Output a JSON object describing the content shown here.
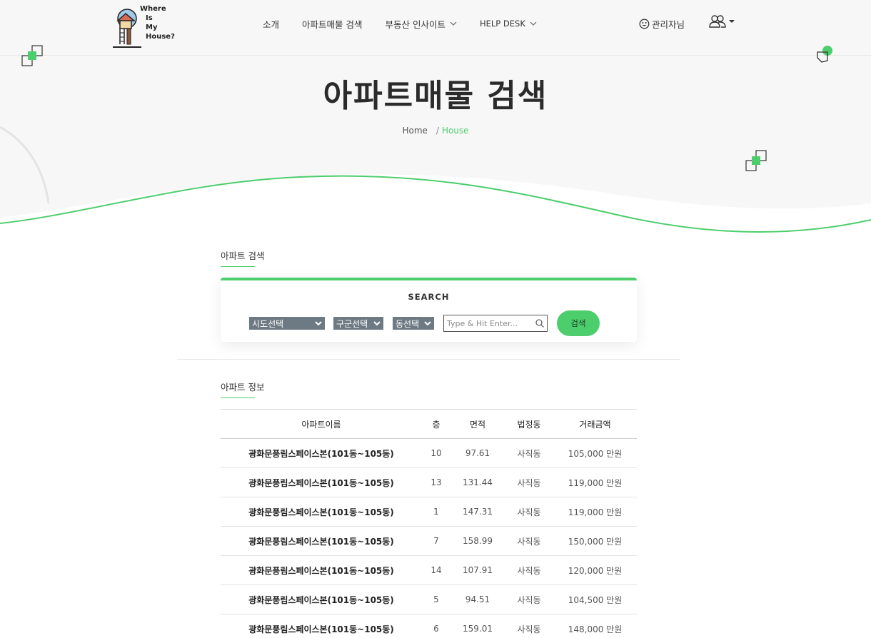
{
  "header": {
    "logo_text": [
      "Where",
      "Is",
      "My",
      "House?"
    ],
    "nav": [
      {
        "label": "소개",
        "dropdown": false
      },
      {
        "label": "아파트매물 검색",
        "dropdown": false
      },
      {
        "label": "부동산 인사이트",
        "dropdown": true
      },
      {
        "label": "HELP DESK",
        "dropdown": true
      }
    ],
    "user_label": "관리자님"
  },
  "hero": {
    "title": "아파트매물 검색",
    "breadcrumb_home": "Home",
    "breadcrumb_sep": "/",
    "breadcrumb_current": "House"
  },
  "search_section": {
    "label": "아파트 검색",
    "title": "SEARCH",
    "sido": "시도선택",
    "gugun": "구군선택",
    "dong": "동선택",
    "placeholder": "Type & Hit Enter...",
    "button": "검색"
  },
  "info_section": {
    "label": "아파트 정보"
  },
  "table": {
    "headers": [
      "아파트이름",
      "층",
      "면적",
      "법정동",
      "거래금액"
    ],
    "rows": [
      [
        "광화문풍림스페이스본(101동~105동)",
        "10",
        "97.61",
        "사직동",
        "105,000 만원"
      ],
      [
        "광화문풍림스페이스본(101동~105동)",
        "13",
        "131.44",
        "사직동",
        "119,000 만원"
      ],
      [
        "광화문풍림스페이스본(101동~105동)",
        "1",
        "147.31",
        "사직동",
        "119,000 만원"
      ],
      [
        "광화문풍림스페이스본(101동~105동)",
        "7",
        "158.99",
        "사직동",
        "150,000 만원"
      ],
      [
        "광화문풍림스페이스본(101동~105동)",
        "14",
        "107.91",
        "사직동",
        "120,000 만원"
      ],
      [
        "광화문풍림스페이스본(101동~105동)",
        "5",
        "94.51",
        "사직동",
        "104,500 만원"
      ],
      [
        "광화문풍림스페이스본(101동~105동)",
        "6",
        "159.01",
        "사직동",
        "148,000 만원"
      ]
    ]
  },
  "colors": {
    "accent": "#4cce6c",
    "select_bg": "#6e7a83",
    "hero_bg": "#f7f7f7"
  }
}
